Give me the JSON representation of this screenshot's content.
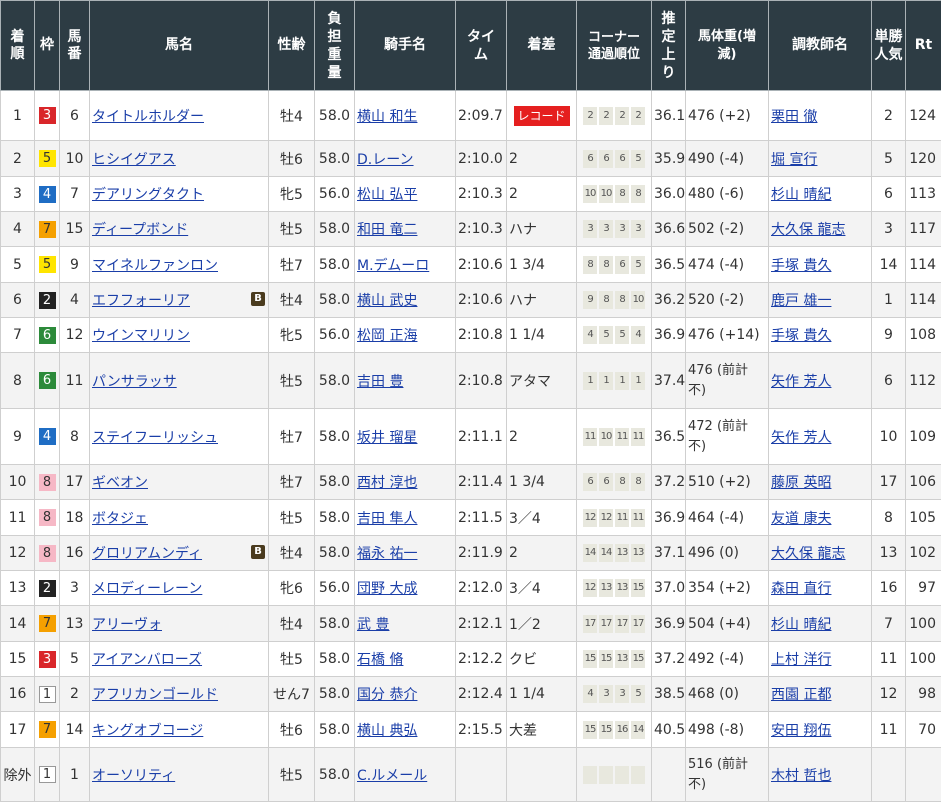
{
  "headers": {
    "rank": "着順",
    "waku": "枠",
    "umaban": "馬番",
    "name": "馬名",
    "sexage": "性齢",
    "weight": "負担重量",
    "jockey": "騎手名",
    "time": "タイム",
    "margin": "着差",
    "corner": "コーナー通過順位",
    "last3f": "推定上り",
    "bodyweight": "馬体重(増減)",
    "trainer": "調教師名",
    "pop": "単勝人気",
    "rt": "Rt"
  },
  "waku_colors": {
    "1": "#ffffff",
    "2": "#222222",
    "3": "#d9262a",
    "4": "#1f6dc4",
    "5": "#ffe500",
    "6": "#2c8a3a",
    "7": "#f5a000",
    "8": "#f6b8c6"
  },
  "rows": [
    {
      "rank": "1",
      "waku": "3",
      "umaban": "6",
      "name": "タイトルホルダー",
      "blinker": "",
      "sexage": "牡4",
      "weight": "58.0",
      "jockey": "横山 和生",
      "time": "2:09.7",
      "margin": "",
      "record": "レコード",
      "corner": [
        "2",
        "2",
        "2",
        "2"
      ],
      "last3f": "36.1",
      "bodyweight": "476 (+2)",
      "trainer": "栗田 徹",
      "pop": "2",
      "rt": "124"
    },
    {
      "rank": "2",
      "waku": "5",
      "umaban": "10",
      "name": "ヒシイグアス",
      "blinker": "",
      "sexage": "牡6",
      "weight": "58.0",
      "jockey": "D.レーン",
      "time": "2:10.0",
      "margin": "2",
      "record": "",
      "corner": [
        "6",
        "6",
        "6",
        "5"
      ],
      "last3f": "35.9",
      "bodyweight": "490 (-4)",
      "trainer": "堀 宣行",
      "pop": "5",
      "rt": "120"
    },
    {
      "rank": "3",
      "waku": "4",
      "umaban": "7",
      "name": "デアリングタクト",
      "blinker": "",
      "sexage": "牝5",
      "weight": "56.0",
      "jockey": "松山 弘平",
      "time": "2:10.3",
      "margin": "2",
      "record": "",
      "corner": [
        "10",
        "10",
        "8",
        "8"
      ],
      "last3f": "36.0",
      "bodyweight": "480 (-6)",
      "trainer": "杉山 晴紀",
      "pop": "6",
      "rt": "113"
    },
    {
      "rank": "4",
      "waku": "7",
      "umaban": "15",
      "name": "ディープボンド",
      "blinker": "",
      "sexage": "牡5",
      "weight": "58.0",
      "jockey": "和田 竜二",
      "time": "2:10.3",
      "margin": "ハナ",
      "record": "",
      "corner": [
        "3",
        "3",
        "3",
        "3"
      ],
      "last3f": "36.6",
      "bodyweight": "502 (-2)",
      "trainer": "大久保 龍志",
      "pop": "3",
      "rt": "117"
    },
    {
      "rank": "5",
      "waku": "5",
      "umaban": "9",
      "name": "マイネルファンロン",
      "blinker": "",
      "sexage": "牡7",
      "weight": "58.0",
      "jockey": "M.デムーロ",
      "time": "2:10.6",
      "margin": "1 3/4",
      "record": "",
      "corner": [
        "8",
        "8",
        "6",
        "5"
      ],
      "last3f": "36.5",
      "bodyweight": "474 (-4)",
      "trainer": "手塚 貴久",
      "pop": "14",
      "rt": "114"
    },
    {
      "rank": "6",
      "waku": "2",
      "umaban": "4",
      "name": "エフフォーリア",
      "blinker": "B",
      "sexage": "牡4",
      "weight": "58.0",
      "jockey": "横山 武史",
      "time": "2:10.6",
      "margin": "ハナ",
      "record": "",
      "corner": [
        "9",
        "8",
        "8",
        "10"
      ],
      "last3f": "36.2",
      "bodyweight": "520 (-2)",
      "trainer": "鹿戸 雄一",
      "pop": "1",
      "rt": "114"
    },
    {
      "rank": "7",
      "waku": "6",
      "umaban": "12",
      "name": "ウインマリリン",
      "blinker": "",
      "sexage": "牝5",
      "weight": "56.0",
      "jockey": "松岡 正海",
      "time": "2:10.8",
      "margin": "1 1/4",
      "record": "",
      "corner": [
        "4",
        "5",
        "5",
        "4"
      ],
      "last3f": "36.9",
      "bodyweight": "476 (+14)",
      "trainer": "手塚 貴久",
      "pop": "9",
      "rt": "108"
    },
    {
      "rank": "8",
      "waku": "6",
      "umaban": "11",
      "name": "パンサラッサ",
      "blinker": "",
      "sexage": "牡5",
      "weight": "58.0",
      "jockey": "吉田 豊",
      "time": "2:10.8",
      "margin": "アタマ",
      "record": "",
      "corner": [
        "1",
        "1",
        "1",
        "1"
      ],
      "last3f": "37.4",
      "bodyweight": "476 (前計不)",
      "trainer": "矢作 芳人",
      "pop": "6",
      "rt": "112"
    },
    {
      "rank": "9",
      "waku": "4",
      "umaban": "8",
      "name": "ステイフーリッシュ",
      "blinker": "",
      "sexage": "牡7",
      "weight": "58.0",
      "jockey": "坂井 瑠星",
      "time": "2:11.1",
      "margin": "2",
      "record": "",
      "corner": [
        "11",
        "10",
        "11",
        "11"
      ],
      "last3f": "36.5",
      "bodyweight": "472 (前計不)",
      "trainer": "矢作 芳人",
      "pop": "10",
      "rt": "109"
    },
    {
      "rank": "10",
      "waku": "8",
      "umaban": "17",
      "name": "ギベオン",
      "blinker": "",
      "sexage": "牡7",
      "weight": "58.0",
      "jockey": "西村 淳也",
      "time": "2:11.4",
      "margin": "1 3/4",
      "record": "",
      "corner": [
        "6",
        "6",
        "8",
        "8"
      ],
      "last3f": "37.2",
      "bodyweight": "510 (+2)",
      "trainer": "藤原 英昭",
      "pop": "17",
      "rt": "106"
    },
    {
      "rank": "11",
      "waku": "8",
      "umaban": "18",
      "name": "ボタジェ",
      "blinker": "",
      "sexage": "牡5",
      "weight": "58.0",
      "jockey": "吉田 隼人",
      "time": "2:11.5",
      "margin": "3／4",
      "record": "",
      "corner": [
        "12",
        "12",
        "11",
        "11"
      ],
      "last3f": "36.9",
      "bodyweight": "464 (-4)",
      "trainer": "友道 康夫",
      "pop": "8",
      "rt": "105"
    },
    {
      "rank": "12",
      "waku": "8",
      "umaban": "16",
      "name": "グロリアムンディ",
      "blinker": "B",
      "sexage": "牡4",
      "weight": "58.0",
      "jockey": "福永 祐一",
      "time": "2:11.9",
      "margin": "2",
      "record": "",
      "corner": [
        "14",
        "14",
        "13",
        "13"
      ],
      "last3f": "37.1",
      "bodyweight": "496 (0)",
      "trainer": "大久保 龍志",
      "pop": "13",
      "rt": "102"
    },
    {
      "rank": "13",
      "waku": "2",
      "umaban": "3",
      "name": "メロディーレーン",
      "blinker": "",
      "sexage": "牝6",
      "weight": "56.0",
      "jockey": "団野 大成",
      "time": "2:12.0",
      "margin": "3／4",
      "record": "",
      "corner": [
        "12",
        "13",
        "13",
        "15"
      ],
      "last3f": "37.0",
      "bodyweight": "354 (+2)",
      "trainer": "森田 直行",
      "pop": "16",
      "rt": "97"
    },
    {
      "rank": "14",
      "waku": "7",
      "umaban": "13",
      "name": "アリーヴォ",
      "blinker": "",
      "sexage": "牡4",
      "weight": "58.0",
      "jockey": "武 豊",
      "time": "2:12.1",
      "margin": "1／2",
      "record": "",
      "corner": [
        "17",
        "17",
        "17",
        "17"
      ],
      "last3f": "36.9",
      "bodyweight": "504 (+4)",
      "trainer": "杉山 晴紀",
      "pop": "7",
      "rt": "100"
    },
    {
      "rank": "15",
      "waku": "3",
      "umaban": "5",
      "name": "アイアンバローズ",
      "blinker": "",
      "sexage": "牡5",
      "weight": "58.0",
      "jockey": "石橋 脩",
      "time": "2:12.2",
      "margin": "クビ",
      "record": "",
      "corner": [
        "15",
        "15",
        "13",
        "15"
      ],
      "last3f": "37.2",
      "bodyweight": "492 (-4)",
      "trainer": "上村 洋行",
      "pop": "11",
      "rt": "100"
    },
    {
      "rank": "16",
      "waku": "1",
      "umaban": "2",
      "name": "アフリカンゴールド",
      "blinker": "",
      "sexage": "せん7",
      "weight": "58.0",
      "jockey": "国分 恭介",
      "time": "2:12.4",
      "margin": "1 1/4",
      "record": "",
      "corner": [
        "4",
        "3",
        "3",
        "5"
      ],
      "last3f": "38.5",
      "bodyweight": "468 (0)",
      "trainer": "西園 正都",
      "pop": "12",
      "rt": "98"
    },
    {
      "rank": "17",
      "waku": "7",
      "umaban": "14",
      "name": "キングオブコージ",
      "blinker": "",
      "sexage": "牡6",
      "weight": "58.0",
      "jockey": "横山 典弘",
      "time": "2:15.5",
      "margin": "大差",
      "record": "",
      "corner": [
        "15",
        "15",
        "16",
        "14"
      ],
      "last3f": "40.5",
      "bodyweight": "498 (-8)",
      "trainer": "安田 翔伍",
      "pop": "11",
      "rt": "70"
    },
    {
      "rank": "除外",
      "waku": "1",
      "umaban": "1",
      "name": "オーソリティ",
      "blinker": "",
      "sexage": "牡5",
      "weight": "58.0",
      "jockey": "C.ルメール",
      "time": "",
      "margin": "",
      "record": "",
      "corner": [
        "",
        "",
        "",
        ""
      ],
      "last3f": "",
      "bodyweight": "516 (前計不)",
      "trainer": "木村 哲也",
      "pop": "",
      "rt": ""
    }
  ]
}
